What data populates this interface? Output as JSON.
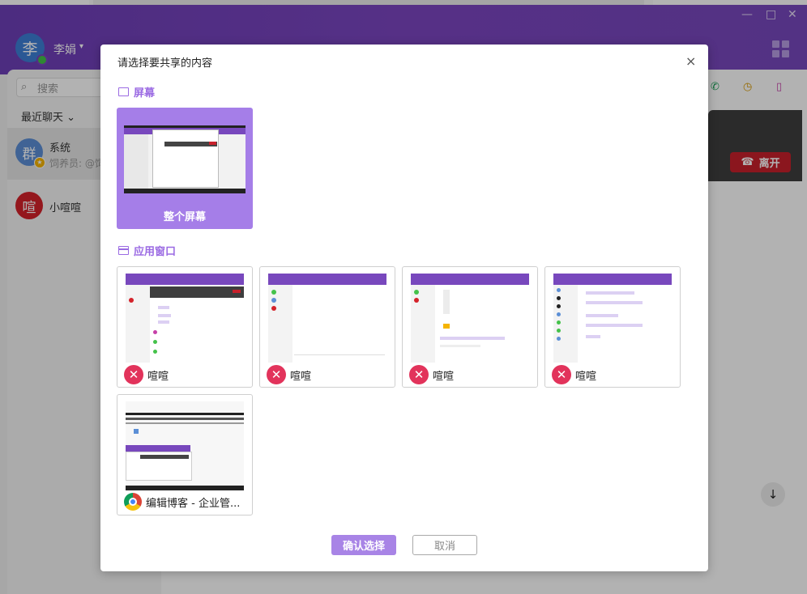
{
  "colors": {
    "brand_purple": "#7848bd",
    "accent_purple": "#9b6be3",
    "selected_card": "#a57ee8",
    "leave_red": "#c8202b"
  },
  "app": {
    "user_avatar_char": "李",
    "username": "李娟",
    "username_caret": "▾",
    "search_placeholder": "搜索",
    "recent_label": "最近聊天",
    "recent_caret": "⌄",
    "conversations": [
      {
        "avatar_char": "群",
        "name": "系统",
        "preview": "饲养员: @饲"
      },
      {
        "avatar_char": "喧",
        "name": "小喧喧"
      }
    ],
    "leave_label": "离开",
    "window_controls": [
      "—",
      "□",
      "✕"
    ]
  },
  "dialog": {
    "title": "请选择要共享的内容",
    "close_icon": "×",
    "screen_section_label": "屏幕",
    "screen_card_label": "整个屏幕",
    "window_section_label": "应用窗口",
    "windows": [
      {
        "app_icon": "xuanxuan-icon",
        "label": "喧喧"
      },
      {
        "app_icon": "xuanxuan-icon",
        "label": "喧喧"
      },
      {
        "app_icon": "xuanxuan-icon",
        "label": "喧喧"
      },
      {
        "app_icon": "xuanxuan-icon",
        "label": "喧喧"
      },
      {
        "app_icon": "chrome-icon",
        "label": "编辑博客 - 企业管..."
      }
    ],
    "confirm_label": "确认选择",
    "cancel_label": "取消"
  }
}
